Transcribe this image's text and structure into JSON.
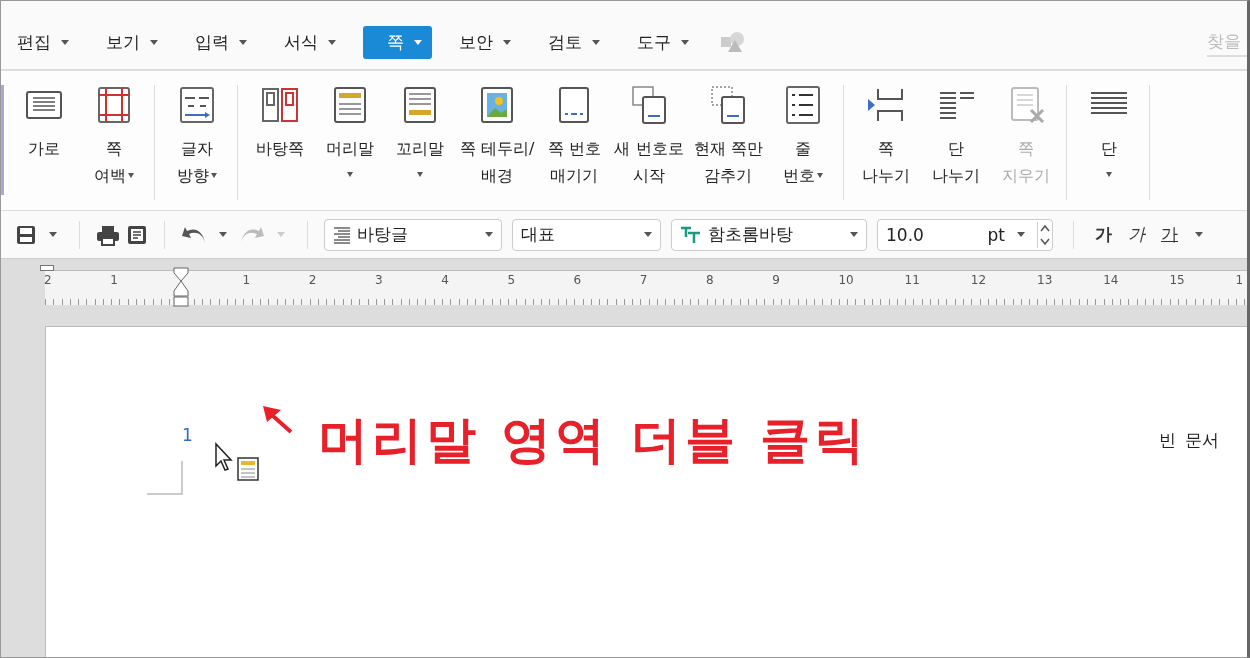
{
  "menu": [
    {
      "label": "편집",
      "selected": false
    },
    {
      "label": "보기",
      "selected": false
    },
    {
      "label": "입력",
      "selected": false
    },
    {
      "label": "서식",
      "selected": false
    },
    {
      "label": "쪽",
      "selected": true
    },
    {
      "label": "보안",
      "selected": false
    },
    {
      "label": "검토",
      "selected": false
    },
    {
      "label": "도구",
      "selected": false
    }
  ],
  "search": {
    "placeholder": "찾을"
  },
  "ribbon": [
    [
      {
        "lines": [
          "가로"
        ],
        "dropdown": false,
        "disabled": false
      },
      {
        "lines": [
          "쪽",
          "여백"
        ],
        "dropdown": true,
        "disabled": false
      }
    ],
    [
      {
        "lines": [
          "글자",
          "방향"
        ],
        "dropdown": true,
        "disabled": false
      }
    ],
    [
      {
        "lines": [
          "바탕쪽"
        ],
        "dropdown": false,
        "disabled": false
      },
      {
        "lines": [
          "머리말"
        ],
        "dropdown": true,
        "disabled": false
      },
      {
        "lines": [
          "꼬리말"
        ],
        "dropdown": true,
        "disabled": false
      },
      {
        "lines": [
          "쪽 테두리/",
          "배경"
        ],
        "dropdown": false,
        "disabled": false
      },
      {
        "lines": [
          "쪽 번호",
          "매기기"
        ],
        "dropdown": false,
        "disabled": false
      },
      {
        "lines": [
          "새 번호로",
          "시작"
        ],
        "dropdown": false,
        "disabled": false
      },
      {
        "lines": [
          "현재 쪽만",
          "감추기"
        ],
        "dropdown": false,
        "disabled": false
      },
      {
        "lines": [
          "줄",
          "번호"
        ],
        "dropdown": true,
        "disabled": false
      }
    ],
    [
      {
        "lines": [
          "쪽",
          "나누기"
        ],
        "dropdown": false,
        "disabled": false
      },
      {
        "lines": [
          "단",
          "나누기"
        ],
        "dropdown": false,
        "disabled": false
      },
      {
        "lines": [
          "쪽",
          "지우기"
        ],
        "dropdown": false,
        "disabled": true
      }
    ],
    [
      {
        "lines": [
          "단"
        ],
        "dropdown": true,
        "disabled": false
      }
    ]
  ],
  "toolbar": {
    "style": "바탕글",
    "style_group": "대표",
    "font": "함초롬바탕",
    "size": "10.0",
    "unit": "pt",
    "bold": "가",
    "italic": "가",
    "underline": "가"
  },
  "ruler": [
    "2",
    "1",
    "1",
    "2",
    "3",
    "4",
    "5",
    "6",
    "7",
    "8",
    "9",
    "10",
    "11",
    "12",
    "13",
    "14",
    "15",
    "1"
  ],
  "document": {
    "page_number": "1",
    "annotation": "머리말 영역 더블 클릭",
    "title": "빈 문서"
  }
}
